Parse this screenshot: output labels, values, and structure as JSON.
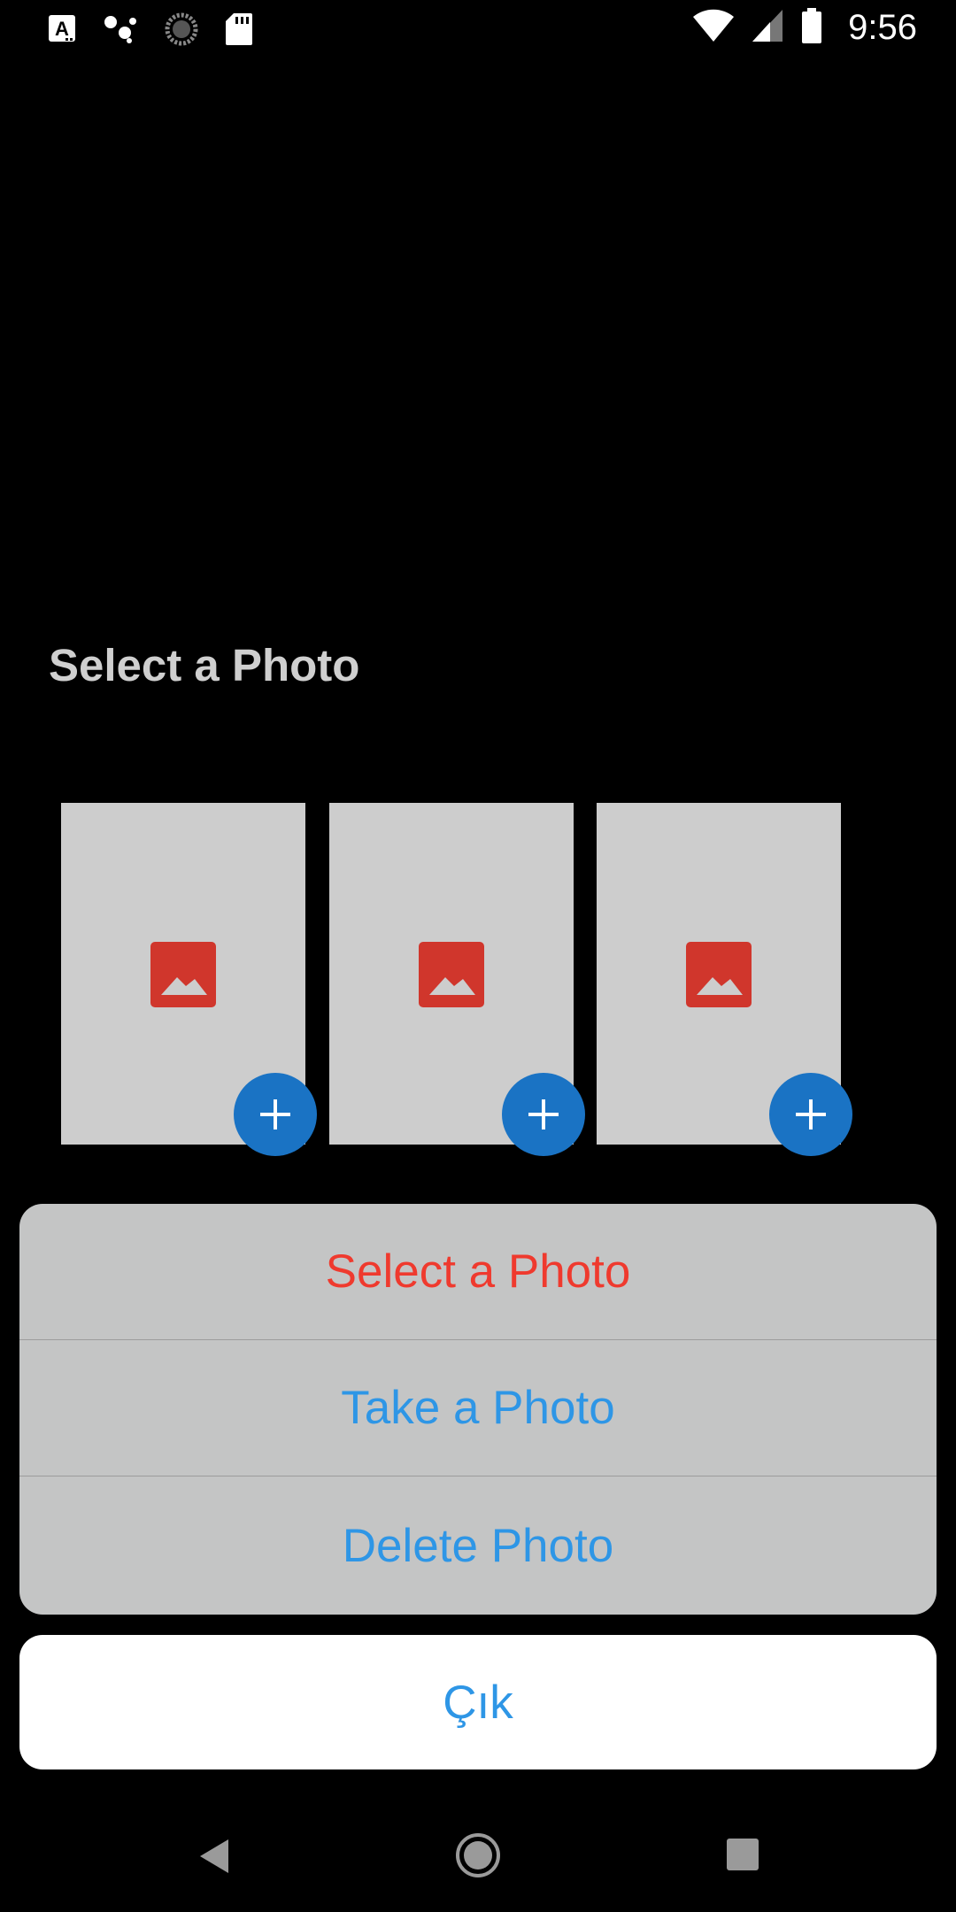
{
  "status_bar": {
    "time": "9:56",
    "icons": [
      "text-a-icon",
      "assistant-dots-icon",
      "sync-progress-icon",
      "sd-card-icon",
      "wifi-icon",
      "cell-signal-icon",
      "battery-icon"
    ]
  },
  "page": {
    "title": "Select a Photo"
  },
  "photo_slots": [
    {
      "icon": "image-placeholder-icon",
      "add_icon": "plus-icon"
    },
    {
      "icon": "image-placeholder-icon",
      "add_icon": "plus-icon"
    },
    {
      "icon": "image-placeholder-icon",
      "add_icon": "plus-icon"
    }
  ],
  "action_sheet": {
    "items": [
      {
        "label": "Select a Photo",
        "style": "destructive"
      },
      {
        "label": "Take a Photo",
        "style": "normal"
      },
      {
        "label": "Delete Photo",
        "style": "normal"
      }
    ],
    "cancel_label": "Çık"
  },
  "nav_bar": {
    "icons": [
      "back-icon",
      "home-icon",
      "recents-icon"
    ]
  },
  "colors": {
    "accent_blue": "#1a73c4",
    "destructive_red": "#ef3a2e",
    "link_blue": "#2e96e6",
    "image_icon_red": "#d0362c"
  }
}
